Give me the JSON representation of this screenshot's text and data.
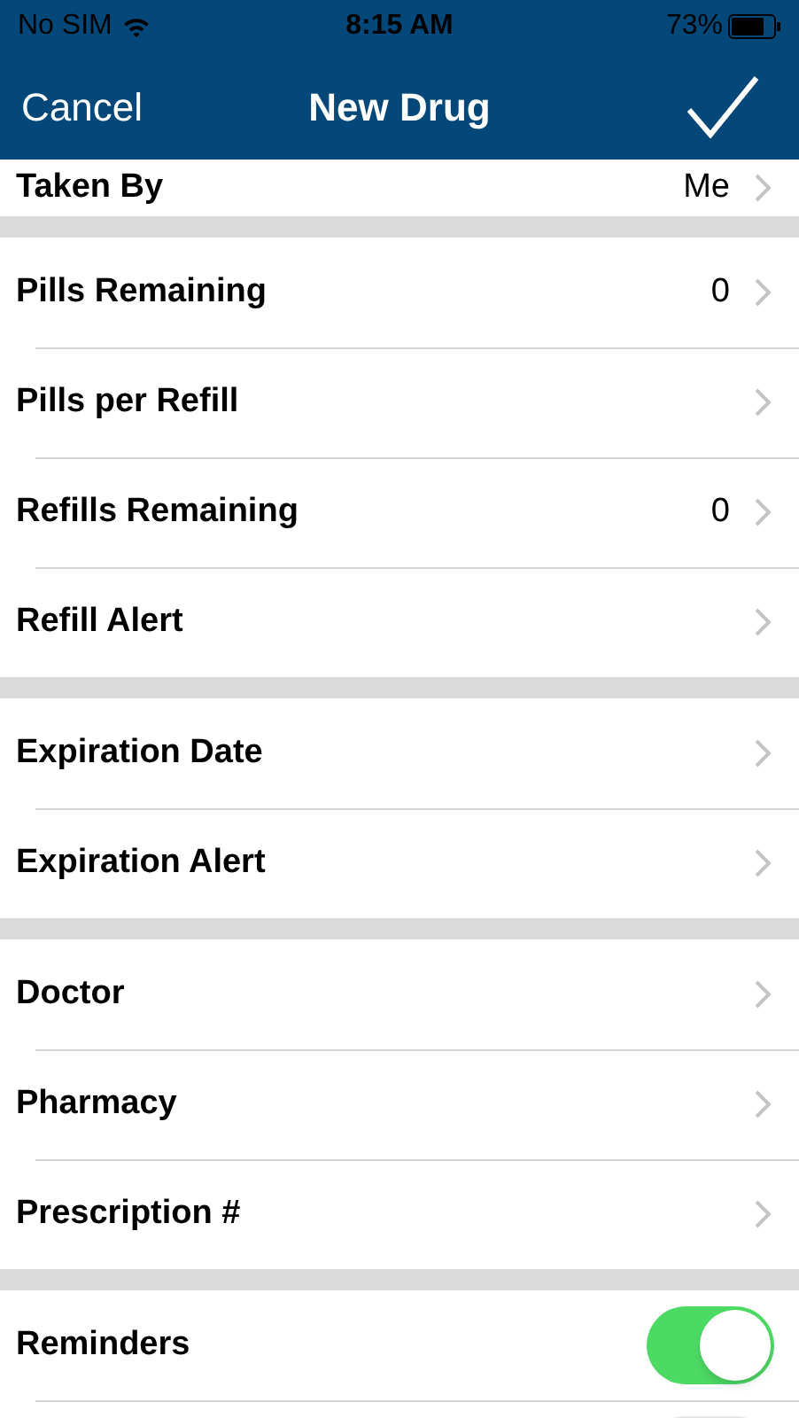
{
  "status_bar": {
    "carrier": "No SIM",
    "time": "8:15 AM",
    "battery": "73%"
  },
  "nav_bar": {
    "left_button": "Cancel",
    "title": "New Drug"
  },
  "sections": [
    {
      "rows": [
        {
          "kind": "disclosure",
          "label": "Taken By",
          "value": "Me"
        }
      ]
    },
    {
      "rows": [
        {
          "kind": "disclosure",
          "label": "Pills Remaining",
          "value": "0"
        },
        {
          "kind": "disclosure",
          "label": "Pills per Refill"
        },
        {
          "kind": "disclosure",
          "label": "Refills Remaining",
          "value": "0"
        },
        {
          "kind": "disclosure",
          "label": "Refill Alert"
        }
      ]
    },
    {
      "rows": [
        {
          "kind": "disclosure",
          "label": "Expiration Date"
        },
        {
          "kind": "disclosure",
          "label": "Expiration Alert"
        }
      ]
    },
    {
      "rows": [
        {
          "kind": "disclosure",
          "label": "Doctor"
        },
        {
          "kind": "disclosure",
          "label": "Pharmacy"
        },
        {
          "kind": "disclosure",
          "label": "Prescription #"
        }
      ]
    },
    {
      "rows": [
        {
          "kind": "toggle",
          "label": "Reminders",
          "on": true
        },
        {
          "kind": "toggle",
          "on": false
        }
      ]
    }
  ]
}
